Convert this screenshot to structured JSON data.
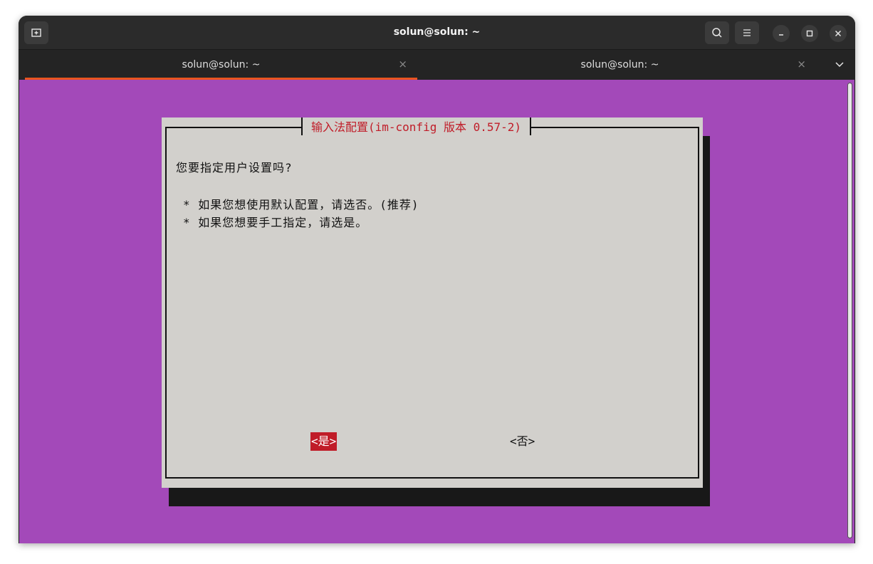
{
  "window": {
    "title": "solun@solun: ~"
  },
  "tabs": [
    {
      "label": "solun@solun: ~",
      "active": true
    },
    {
      "label": "solun@solun: ~",
      "active": false
    }
  ],
  "icons": {
    "new_tab": "new-tab-icon",
    "search": "search-icon",
    "menu": "hamburger-menu-icon",
    "minimize": "minimize-icon",
    "maximize": "maximize-icon",
    "close": "close-icon",
    "tab_close": "×",
    "tab_dropdown": "chevron-down-icon"
  },
  "colors": {
    "terminal_bg": "#a349b9",
    "dialog_bg": "#d2d0cc",
    "accent": "#e95420",
    "highlight": "#c01c28"
  },
  "dialog": {
    "title": "输入法配置(im-config 版本 0.57-2)",
    "question": "您要指定用户设置吗?",
    "bullets": [
      "* 如果您想使用默认配置，请选否。(推荐)",
      "* 如果您想要手工指定，请选是。"
    ],
    "yes_button": "<是>",
    "no_button": "<否>"
  }
}
